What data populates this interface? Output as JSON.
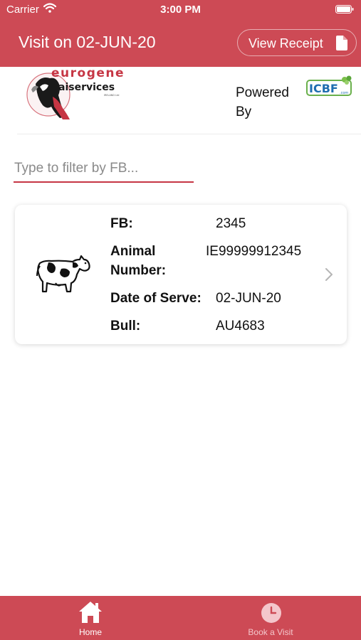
{
  "status_bar": {
    "carrier": "Carrier",
    "time": "3:00 PM"
  },
  "header": {
    "title": "Visit on 02-JUN-20",
    "receipt_button": "View Receipt"
  },
  "logos": {
    "brand_top": "eurogene",
    "brand_bottom": "aiservices",
    "brand_small": "IRELAND Ltd",
    "powered_by": [
      "Powered",
      "By"
    ],
    "partner": "ICBF",
    "partner_suffix": ".com"
  },
  "filter": {
    "placeholder": "Type to filter by FB...",
    "value": ""
  },
  "records": [
    {
      "fields": [
        {
          "label": "FB:",
          "value": "2345"
        },
        {
          "label": "Animal Number:",
          "label_lines": [
            "Animal",
            "Number:"
          ],
          "value": "IE99999912345"
        },
        {
          "label": "Date of Serve:",
          "value": "02-JUN-20"
        },
        {
          "label": "Bull:",
          "value": "AU4683"
        }
      ],
      "icon": "cow-icon"
    }
  ],
  "tabs": [
    {
      "label": "Home",
      "icon": "home-icon",
      "active": true
    },
    {
      "label": "Book a Visit",
      "icon": "clock-icon",
      "active": false
    }
  ],
  "colors": {
    "accent": "#cd4a55",
    "underline": "#c63644",
    "tab_inactive": "#f4c6cb"
  }
}
